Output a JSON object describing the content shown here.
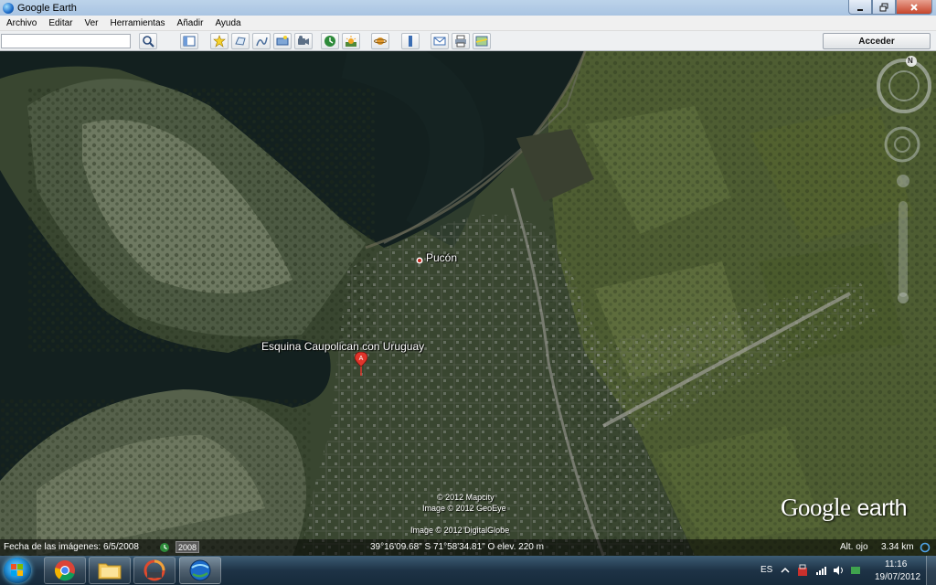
{
  "window": {
    "title": "Google Earth"
  },
  "menu": [
    "Archivo",
    "Editar",
    "Ver",
    "Herramientas",
    "Añadir",
    "Ayuda"
  ],
  "toolbar": {
    "search_value": "",
    "buttons": [
      "search-icon",
      "sidebar-icon",
      "placemark-icon",
      "polygon-icon",
      "path-icon",
      "image-overlay-icon",
      "record-tour-icon",
      "historical-imagery-icon",
      "sunlight-icon",
      "planets-icon",
      "ruler-icon",
      "email-icon",
      "print-icon",
      "view-in-maps-icon"
    ],
    "signin_label": "Acceder"
  },
  "map": {
    "labels": {
      "town": "Pucón",
      "placemark": "Esquina Caupolican con Uruguay"
    },
    "attribution": [
      "© 2012 Mapcity",
      "Image © 2012 GeoEye",
      "Image © 2012 DigitalGlobe"
    ],
    "logo": {
      "google": "Google",
      "earth": "earth"
    },
    "status": {
      "imagery_date": "Fecha de las imágenes: 6/5/2008",
      "year": "2008",
      "coordinates": "39°16'09.68\" S   71°58'34.81\" O  elev.  220 m",
      "eye_alt_label": "Alt. ojo",
      "eye_alt_value": "3.34 km"
    },
    "compass": "N"
  },
  "taskbar": {
    "language": "ES",
    "time": "11:16",
    "date": "19/07/2012",
    "apps": [
      "windows-explorer-icon",
      "chrome-icon",
      "folder-icon",
      "media-icon",
      "google-earth-icon"
    ]
  },
  "colors": {
    "water": "#13201f",
    "land": "#3b4830",
    "field": "#546336",
    "titlebar": "#bcd3ea"
  }
}
